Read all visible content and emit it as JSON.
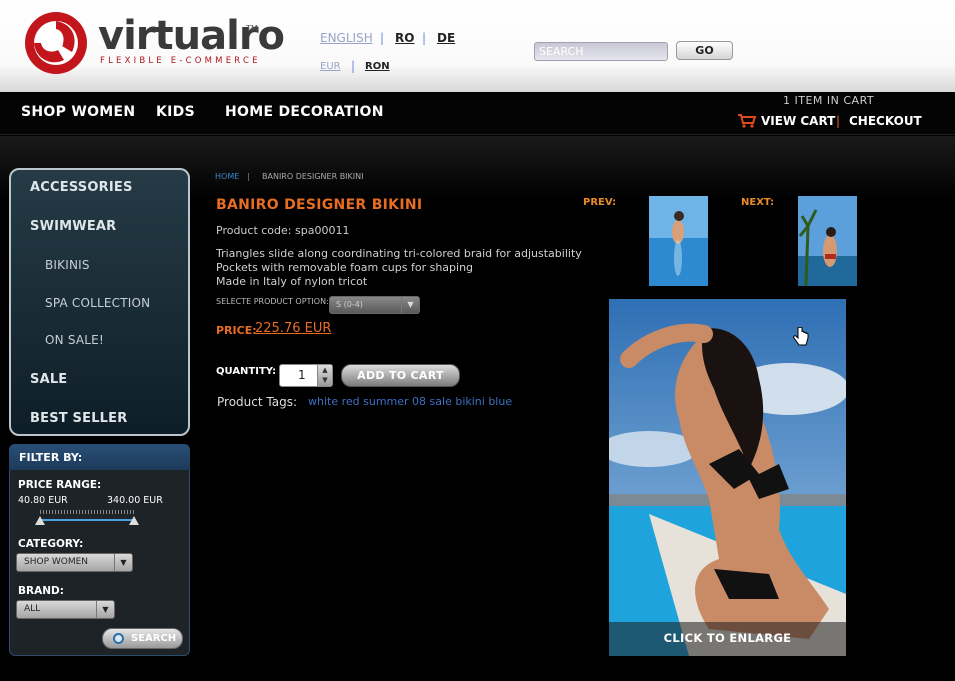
{
  "header": {
    "logo": {
      "name": "virtualro",
      "tm": "TM",
      "tagline": "FLEXIBLE E-COMMERCE"
    },
    "languages": [
      "ENGLISH",
      "RO",
      "DE"
    ],
    "currencies": [
      "EUR",
      "RON"
    ],
    "search": {
      "placeholder": "SEARCH",
      "button": "GO"
    }
  },
  "nav": {
    "items": [
      "SHOP WOMEN",
      "KIDS",
      "HOME DECORATION"
    ],
    "cart_count": "1 ITEM IN CART",
    "view_cart": "VIEW CART",
    "checkout": "CHECKOUT"
  },
  "sidebar": {
    "items": [
      {
        "label": "ACCESSORIES",
        "level": 1
      },
      {
        "label": "SWIMWEAR",
        "level": 1
      },
      {
        "label": "BIKINIS",
        "level": 2
      },
      {
        "label": "SPA COLLECTION",
        "level": 2
      },
      {
        "label": "ON SALE!",
        "level": 2
      },
      {
        "label": "SALE",
        "level": 1
      },
      {
        "label": "BEST SELLER",
        "level": 1
      }
    ]
  },
  "filter": {
    "title": "FILTER BY:",
    "price_label": "PRICE RANGE:",
    "price_min": "40.80 EUR",
    "price_max": "340.00 EUR",
    "category_label": "CATEGORY:",
    "category_value": "SHOP WOMEN",
    "brand_label": "BRAND:",
    "brand_value": "ALL",
    "search_button": "SEARCH"
  },
  "breadcrumb": [
    "HOME",
    "BANIRO DESIGNER BIKINI"
  ],
  "product": {
    "title": "BANIRO DESIGNER BIKINI",
    "code": "Product code:  spa00011",
    "description": [
      "Triangles slide along coordinating tri-colored braid for adjustability",
      "Pockets with removable foam cups for shaping",
      "Made in Italy of nylon tricot"
    ],
    "option_label": "SELECTE PRODUCT OPTION:",
    "option_value": "S (0-4)",
    "price_label": "PRICE:",
    "price": "225.76 EUR",
    "quantity_label": "QUANTITY:",
    "quantity": "1",
    "add_to_cart": "ADD TO CART",
    "tags_label": "Product Tags:",
    "tags": "white red summer 08 sale bikini blue",
    "prev_label": "PREV:",
    "next_label": "NEXT:",
    "enlarge": "CLICK TO ENLARGE"
  },
  "colors": {
    "accent_orange": "#e86c22",
    "link_blue": "#3d6fc2",
    "brand_red": "#b0171c"
  }
}
